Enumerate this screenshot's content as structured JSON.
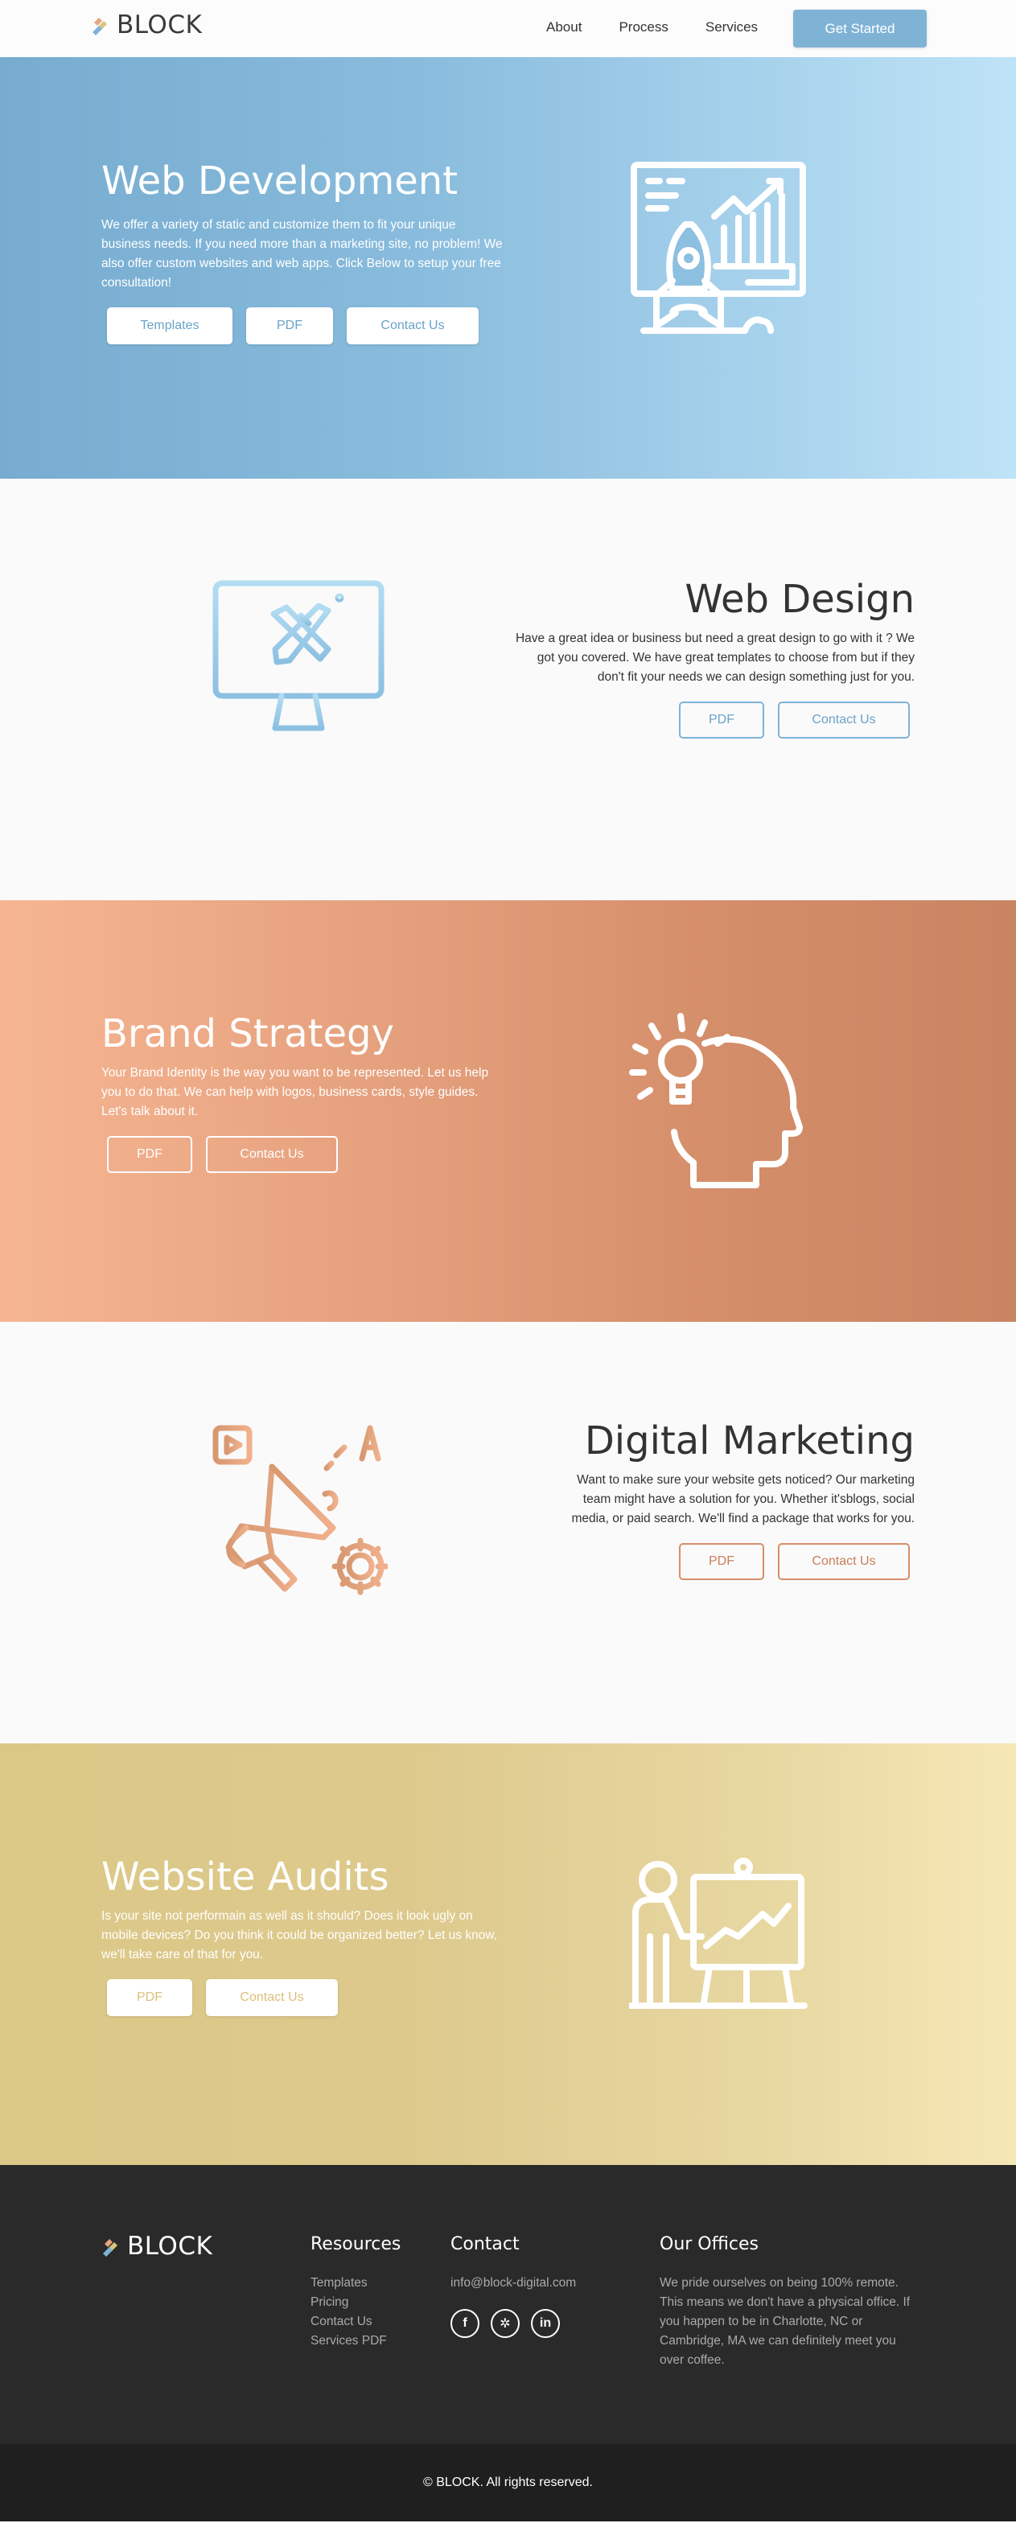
{
  "brand": {
    "name": "BLOCK"
  },
  "nav": {
    "links": [
      "About",
      "Process",
      "Services"
    ],
    "cta": "Get Started"
  },
  "sections": {
    "web_development": {
      "title": "Web Development",
      "description": "We offer a variety of static and customize them to fit your unique business needs. If you need more than a marketing site, no problem! We also offer custom websites and web apps. Click Below to setup your free consultation!",
      "buttons": [
        "Templates",
        "PDF",
        "Contact Us"
      ],
      "icon": "rocket-chart-board-icon"
    },
    "web_design": {
      "title": "Web Design",
      "description": "Have a great idea or business but need a great design to go with it ? We got you covered. We have great templates to choose from but if they don't fit your needs we can design something just for you.",
      "buttons": [
        "PDF",
        "Contact Us"
      ],
      "icon": "monitor-design-tools-icon"
    },
    "brand_strategy": {
      "title": "Brand Strategy",
      "description": "Your Brand Identity is the way you want to be represented. Let us help you to do that. We can help with logos, business cards, style guides. Let's talk about it.",
      "buttons": [
        "PDF",
        "Contact Us"
      ],
      "icon": "head-lightbulb-icon"
    },
    "digital_marketing": {
      "title": "Digital Marketing",
      "description": "Want to make sure your website gets noticed? Our marketing team might have a solution for you. Whether it'sblogs, social media, or paid search. We'll find a package that works for you.",
      "buttons": [
        "PDF",
        "Contact Us"
      ],
      "icon": "megaphone-icon"
    },
    "website_audits": {
      "title": "Website Audits",
      "description": "Is your site not performain as well as it should? Does it look ugly on mobile devices? Do you think it could be organized better? Let us know, we'll take care of that for you.",
      "buttons": [
        "PDF",
        "Contact Us"
      ],
      "icon": "presenter-board-icon"
    }
  },
  "footer": {
    "resources": {
      "heading": "Resources",
      "links": [
        "Templates",
        "Pricing",
        "Contact Us",
        "Services PDF"
      ]
    },
    "contact": {
      "heading": "Contact",
      "email": "info@block-digital.com",
      "socials": [
        "facebook-icon",
        "yelp-icon",
        "linkedin-icon"
      ]
    },
    "offices": {
      "heading": "Our Offices",
      "text": "We pride ourselves on being 100% remote. This means we don't have a physical office. If you happen to be in Charlotte, NC or Cambridge, MA we can definitely meet you over coffee."
    },
    "copyright": "© BLOCK. All rights reserved."
  },
  "colors": {
    "blue": "#7fb3d6",
    "peach": "#e49f7c",
    "gold": "#dcc886",
    "dark": "#2a2a2a"
  }
}
